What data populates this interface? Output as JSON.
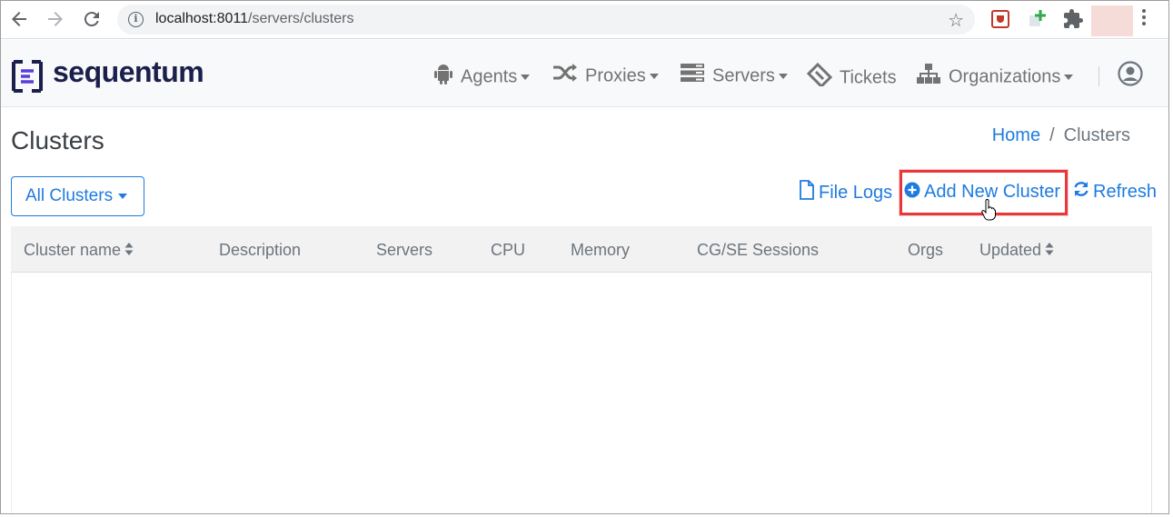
{
  "browser": {
    "url_host": "localhost:8011",
    "url_path": "/servers/clusters"
  },
  "navbar": {
    "brand": "sequentum",
    "items": [
      {
        "label": "Agents",
        "icon": "android-icon",
        "dropdown": true
      },
      {
        "label": "Proxies",
        "icon": "shuffle-icon",
        "dropdown": true
      },
      {
        "label": "Servers",
        "icon": "server-icon",
        "dropdown": true
      },
      {
        "label": "Tickets",
        "icon": "ticket-icon",
        "dropdown": false
      },
      {
        "label": "Organizations",
        "icon": "sitemap-icon",
        "dropdown": true
      }
    ]
  },
  "page": {
    "title": "Clusters",
    "breadcrumb": {
      "home": "Home",
      "separator": "/",
      "current": "Clusters"
    },
    "filter_button": "All Clusters",
    "actions": {
      "file_logs": "File Logs",
      "add_new_cluster": "Add New Cluster",
      "refresh": "Refresh"
    }
  },
  "table": {
    "columns": [
      {
        "label": "Cluster name",
        "sortable": true
      },
      {
        "label": "Description",
        "sortable": false
      },
      {
        "label": "Servers",
        "sortable": false
      },
      {
        "label": "CPU",
        "sortable": false
      },
      {
        "label": "Memory",
        "sortable": false
      },
      {
        "label": "CG/SE Sessions",
        "sortable": false
      },
      {
        "label": "Orgs",
        "sortable": false
      },
      {
        "label": "Updated",
        "sortable": true
      }
    ],
    "rows": []
  },
  "colors": {
    "link": "#1e7be0",
    "highlight": "#e8383b",
    "brand": "#1b1f4b",
    "brand_accent": "#5b3fd9"
  }
}
